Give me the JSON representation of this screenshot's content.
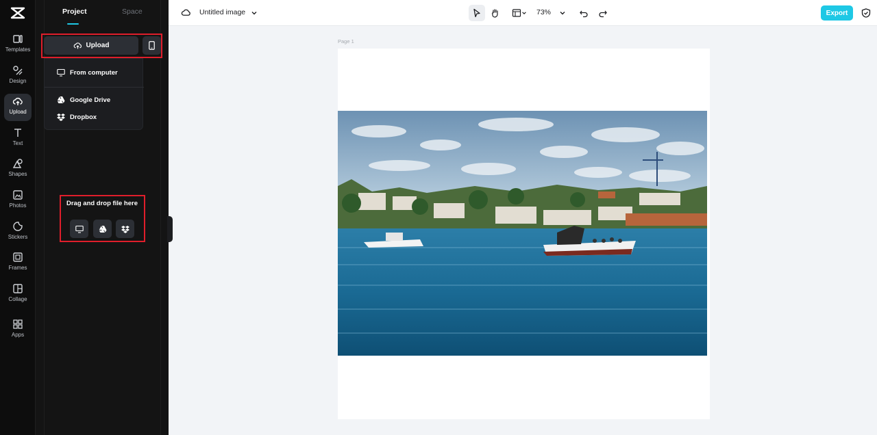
{
  "rail": {
    "items": [
      {
        "label": "Templates"
      },
      {
        "label": "Design"
      },
      {
        "label": "Upload"
      },
      {
        "label": "Text"
      },
      {
        "label": "Shapes"
      },
      {
        "label": "Photos"
      },
      {
        "label": "Stickers"
      },
      {
        "label": "Frames"
      },
      {
        "label": "Collage"
      },
      {
        "label": "Apps"
      }
    ],
    "active": "Upload"
  },
  "panel": {
    "tabs": {
      "project": "Project",
      "space": "Space"
    },
    "upload_label": "Upload",
    "dropdown": {
      "from_computer": "From computer",
      "google_drive": "Google Drive",
      "dropbox": "Dropbox"
    },
    "dropzone_title": "Drag and drop file here"
  },
  "topbar": {
    "title": "Untitled image",
    "zoom": "73%",
    "export_label": "Export"
  },
  "canvas": {
    "page_label": "Page 1"
  },
  "colors": {
    "accent": "#1ec8e5",
    "highlight": "#e01e2b",
    "rail_bg": "#0d0d0d",
    "panel_bg": "#141414"
  }
}
